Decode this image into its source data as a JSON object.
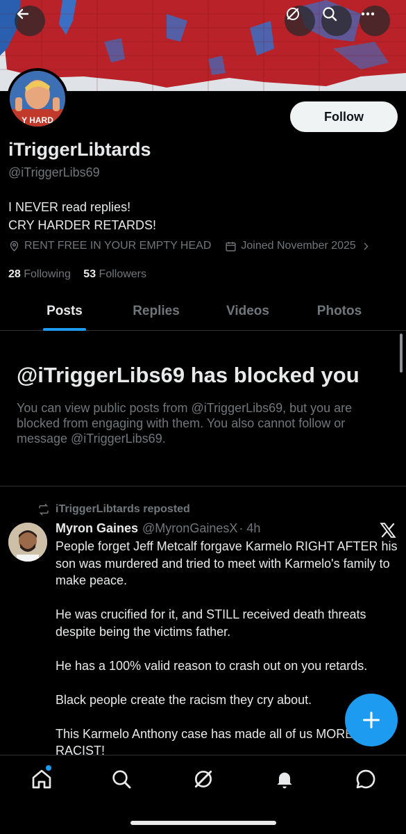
{
  "header": {
    "back_icon": "back-arrow-icon",
    "grok_icon": "grok-icon",
    "search_icon": "search-icon",
    "more_icon": "more-icon",
    "avatar_caption": "Y HARD"
  },
  "profile": {
    "display_name": "iTriggerLibtards",
    "handle": "@iTriggerLibs69",
    "follow_label": "Follow",
    "bio_line1": "I NEVER read replies!",
    "bio_line2": "CRY HARDER RETARDS!",
    "location": "RENT FREE IN YOUR EMPTY HEAD",
    "joined": "Joined November 2025",
    "following_count": "28",
    "following_label": "Following",
    "followers_count": "53",
    "followers_label": "Followers"
  },
  "tabs": [
    {
      "label": "Posts",
      "active": true
    },
    {
      "label": "Replies",
      "active": false
    },
    {
      "label": "Videos",
      "active": false
    },
    {
      "label": "Photos",
      "active": false
    }
  ],
  "blocked": {
    "title": "@iTriggerLibs69 has blocked you",
    "message": "You can view public posts from @iTriggerLibs69, but you are blocked from engaging with them. You also cannot follow or message @iTriggerLibs69."
  },
  "post": {
    "repost_label": "iTriggerLibtards reposted",
    "author_name": "Myron Gaines",
    "author_handle": "@MyronGainesX",
    "time": "· 4h",
    "paragraphs": [
      "People forget Jeff Metcalf forgave Karmelo RIGHT AFTER his son was murdered and tried to meet with Karmelo's family to make peace.",
      "He was crucified for it, and STILL received death threats despite being the victims father.",
      "He has a 100% valid reason to crash out on you retards.",
      "Black people create the racism they cry about.",
      "This Karmelo Anthony case has made all of us MORE RACIST!"
    ]
  },
  "colors": {
    "accent": "#1d9bf0",
    "background": "#000000",
    "text": "#e7e9ea",
    "secondary_text": "#71767b"
  }
}
